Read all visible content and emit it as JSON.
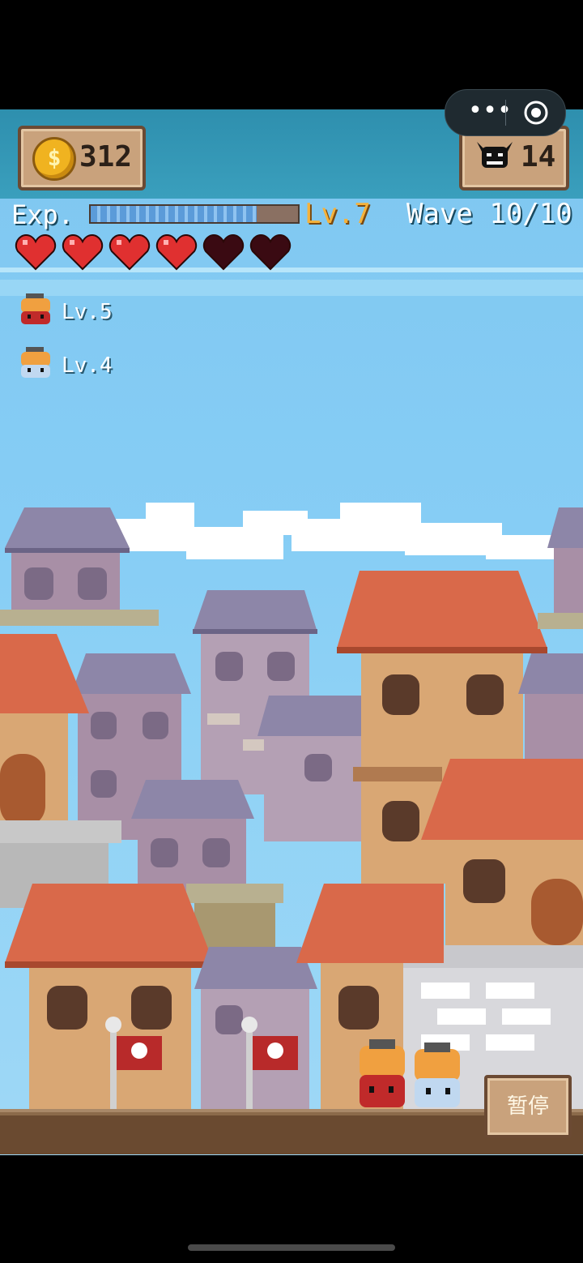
{
  "hud": {
    "coins": "312",
    "enemies": "14",
    "exp_label": "Exp.",
    "exp_progress": 0.8,
    "level": "Lv.7",
    "wave": "Wave 10/10"
  },
  "hearts": {
    "full": 4,
    "empty": 2
  },
  "squad": [
    {
      "name": "red-helmet-soldier",
      "level": "Lv.5"
    },
    {
      "name": "blue-helmet-soldier",
      "level": "Lv.4"
    }
  ],
  "capsule": {
    "more": "•••"
  },
  "pause_label": "暂停",
  "colors": {
    "brick_roof": "#d9694a",
    "slate_roof": "#8d86a8",
    "sky": "#86cdf5",
    "panel": "#c9a27c",
    "heart": "#e03030"
  }
}
